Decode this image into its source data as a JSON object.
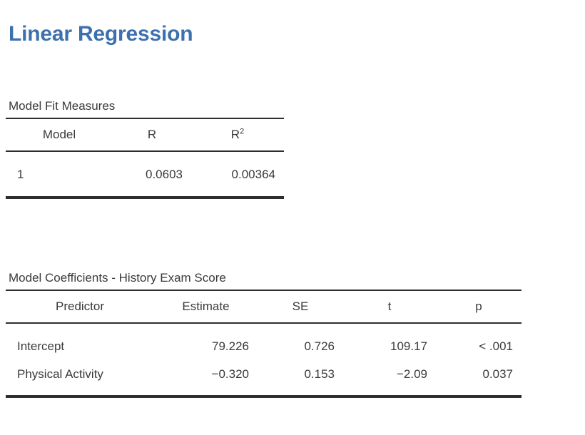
{
  "document": {
    "title": "Linear Regression",
    "title_color": "#3d70ad",
    "text_color": "#3a3a3a",
    "rule_color": "#2e2e2e",
    "background": "#ffffff"
  },
  "tables": [
    {
      "id": "model-fit-measures",
      "caption": "Model Fit Measures",
      "columns": [
        {
          "label": "Model",
          "align": "left"
        },
        {
          "label": "R",
          "align": "right"
        },
        {
          "label": "R²",
          "base": "R",
          "superscript": "2",
          "align": "right"
        }
      ],
      "rows": [
        {
          "cells": [
            "1",
            "0.0603",
            "0.00364"
          ]
        }
      ]
    },
    {
      "id": "model-coefficients",
      "caption": "Model Coefficients - History Exam Score",
      "columns": [
        {
          "label": "Predictor",
          "align": "left"
        },
        {
          "label": "Estimate",
          "align": "right"
        },
        {
          "label": "SE",
          "align": "right"
        },
        {
          "label": "t",
          "align": "right"
        },
        {
          "label": "p",
          "align": "right"
        }
      ],
      "rows": [
        {
          "cells": [
            "Intercept",
            "79.226",
            "0.726",
            "109.17",
            "< .001"
          ]
        },
        {
          "cells": [
            "Physical Activity",
            "−0.320",
            "0.153",
            "−2.09",
            "0.037"
          ]
        }
      ]
    }
  ]
}
